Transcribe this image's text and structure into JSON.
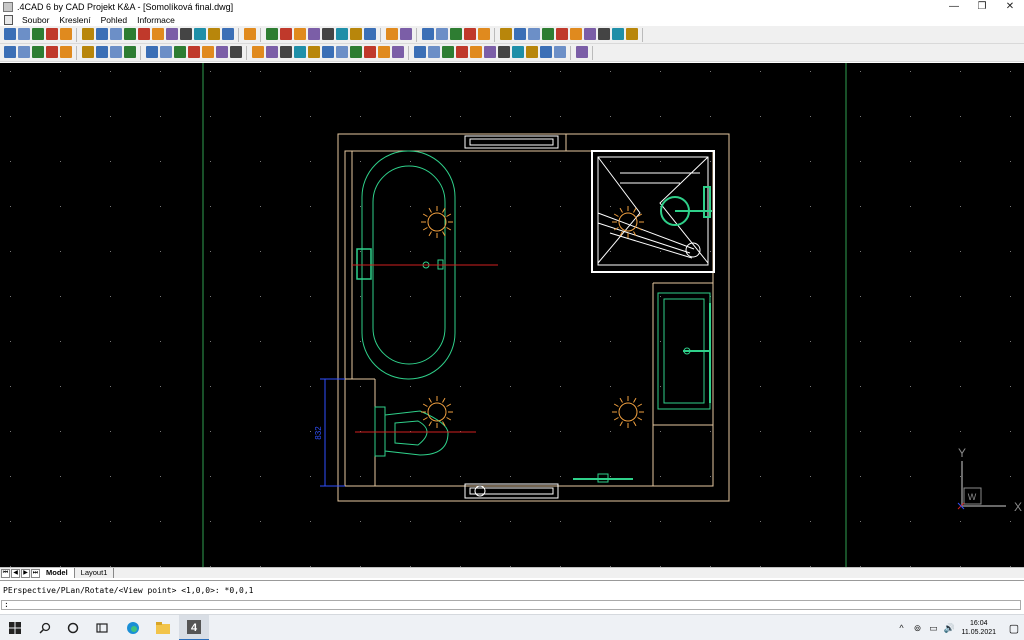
{
  "window": {
    "title": ".4CAD 6 by CAD Projekt K&A - [Somolíková final.dwg]",
    "minimize": "—",
    "maximize": "❐",
    "close": "✕"
  },
  "menu": {
    "items": [
      "Soubor",
      "Kreslení",
      "Pohled",
      "Informace"
    ]
  },
  "drawing": {
    "dimension_label": "832",
    "ucs_x": "X",
    "ucs_y": "Y",
    "ucs_w": "W",
    "colors": {
      "wall": "#e6c8a0",
      "fixture": "#2fd08a",
      "red": "#d02020",
      "sun": "#f0a040",
      "dimension": "#3050ff",
      "shower": "#ffffff",
      "frame": "#2fa050",
      "grid": "#777777"
    }
  },
  "tabs": {
    "nav": [
      "⏮",
      "◀",
      "▶",
      "⏭"
    ],
    "items": [
      "Model",
      "Layout1"
    ],
    "active": "Model"
  },
  "command": {
    "history": "PErspective/PLan/Rotate/<View point> <1,0,0>: *0,0,1",
    "prompt": ":"
  },
  "taskbar": {
    "apps": [
      "start-icon",
      "search-icon",
      "cortana-icon",
      "task-view-icon",
      "edge-icon",
      "explorer-icon",
      "4cad-icon"
    ],
    "clock_time": "16:04",
    "clock_date": "11.05.2021",
    "tray": [
      "^",
      "⊚",
      "▭",
      "🔊"
    ],
    "notif": "▢"
  }
}
